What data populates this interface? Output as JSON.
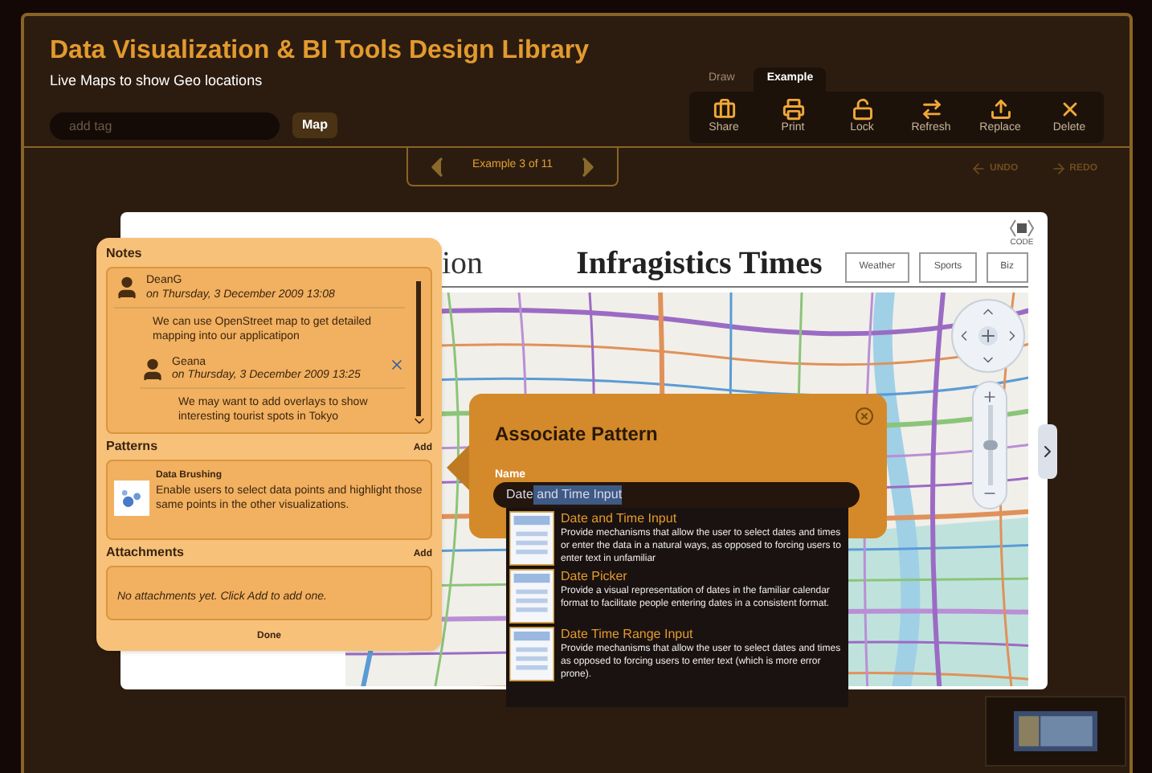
{
  "app": {
    "title": "Data Visualization & BI Tools Design Library",
    "subtitle": "Live Maps to show Geo locations"
  },
  "tag_field": {
    "placeholder": "add tag"
  },
  "tags": [
    {
      "label": "Map"
    }
  ],
  "tabs": [
    {
      "label": "Draw",
      "selected": false
    },
    {
      "label": "Example",
      "selected": true
    }
  ],
  "toolbar": [
    {
      "label": "Share",
      "kind": "share"
    },
    {
      "label": "Print",
      "kind": "print"
    },
    {
      "label": "Lock",
      "kind": "lock"
    },
    {
      "label": "Refresh",
      "kind": "refresh"
    },
    {
      "label": "Replace",
      "kind": "replace"
    },
    {
      "label": "Delete",
      "kind": "delete"
    }
  ],
  "pager": {
    "label": "Example 3 of 11"
  },
  "history": [
    {
      "label": "UNDO",
      "kind": "undo"
    },
    {
      "label": "REDO",
      "kind": "redo"
    }
  ],
  "zoom": {
    "level": 0.5
  },
  "mockup": {
    "title_fragment": "ion",
    "masthead": "Infragistics Times",
    "nav": [
      "Weather",
      "Sports",
      "Biz"
    ],
    "code_label": "CODE"
  },
  "notes_panel": {
    "title": "Notes",
    "notes": [
      {
        "author": "DeanG",
        "date": "on Thursday, 3 December 2009 13:08",
        "text": "We can use OpenStreet map to get detailed mapping into our applicatipon",
        "children": [
          {
            "author": "Geana",
            "date": "on Thursday, 3 December 2009 13:25",
            "text": "We may want to add overlays to show interesting tourist spots in Tokyo"
          }
        ]
      }
    ],
    "patterns": {
      "title": "Patterns",
      "add": "Add",
      "items": [
        {
          "name": "Data Brushing",
          "description": "Enable users to select data points and highlight those same points in the other visualizations."
        }
      ]
    },
    "attachments": {
      "title": "Attachments",
      "add": "Add",
      "empty": "No attachments yet.  Click Add to add one."
    },
    "done": "Done"
  },
  "associate": {
    "title": "Associate Pattern",
    "name_label": "Name",
    "typed": "Date",
    "completion": " and Time Input",
    "suggestions": [
      {
        "name": "Date and Time Input",
        "description": "Provide mechanisms that allow the user to select dates and times or enter the data in a natural ways, as opposed to forcing users to enter text in unfamiliar"
      },
      {
        "name": "Date Picker",
        "description": "Provide a visual representation of dates in the familiar calendar format to facilitate people entering dates in a consistent format."
      },
      {
        "name": "Date Time Range Input",
        "description": "Provide mechanisms that allow the user to select dates and times as opposed to forcing users to enter text (which is more error prone)."
      }
    ]
  }
}
